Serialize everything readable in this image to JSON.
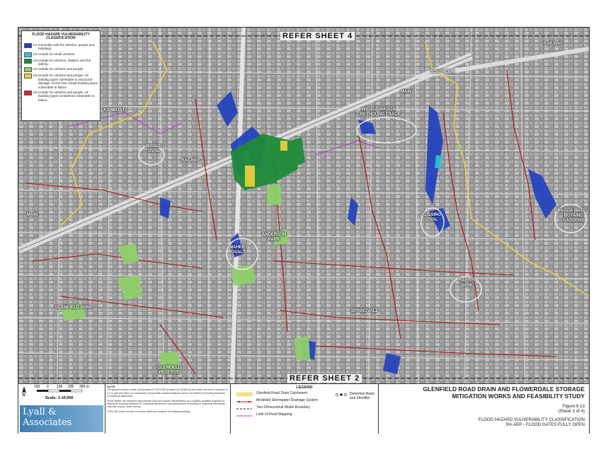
{
  "map": {
    "refer_top": "REFER SHEET 4",
    "refer_bottom": "REFER SHEET 2",
    "labels": {
      "railway_ne": "RAILWAY",
      "southern": "SOUTHERN",
      "main_ne": "MAIN",
      "ashmont": "ASHMONT",
      "wagga_track": "WAGGA WAGGA\nGREYHOUND TRACK",
      "bisson_oval": "BISSON\nOVAL",
      "railway_w": "RAILWAY",
      "main_w": "MAIN",
      "gissing_oval": "GISSING\nOVAL",
      "wagga_gardens": "WAGGA WAGGA\nBOTANIC\nGARDENS",
      "maher_oval": "MAHER\nOVAL",
      "anderson_park": "ANDERSON\nPARK",
      "harris_park": "HARRIS\nPARK",
      "glenfield_park": "GLENFIELD PARK",
      "glenfield_reserve": "GLENFIELD\nRESERVE",
      "springvale": "SPRINGVALE"
    }
  },
  "hazard_legend": {
    "title": "FLOOD HAZARD VULNERABILITY\nCLASSIFICATION",
    "items": [
      {
        "code": "H1",
        "color": "#1f3fbf",
        "text": "Generally safe for vehicles, people and buildings."
      },
      {
        "code": "H2",
        "color": "#27c8d8",
        "text": "Unsafe for small vehicles."
      },
      {
        "code": "H3",
        "color": "#1f8a3a",
        "text": "Unsafe for vehicles, children and the elderly."
      },
      {
        "code": "H4",
        "color": "#8fd06a",
        "text": "Unsafe for vehicles and people."
      },
      {
        "code": "H5",
        "color": "#f0d23a",
        "text": "Unsafe for vehicles and people. All building types vulnerable to structural damage. Some less robust building types vulnerable to failure."
      },
      {
        "code": "H6",
        "color": "#e02020",
        "text": "Unsafe for vehicles and people. All building types considered vulnerable to failure."
      }
    ]
  },
  "scale": {
    "north": "N",
    "ticks": [
      "100",
      "0",
      "100",
      "200",
      "300 m"
    ],
    "label": "Scale: 1:10,000"
  },
  "logo": {
    "line1": "Lyall &",
    "line2": "Associates"
  },
  "notes": {
    "title": "NOTE:",
    "paragraphs": [
      "The ground surface model incorporated in TUFLOW is based on LiDAR survey which has been sampled on a 2 m grid and does not necessarily incorporate localised features which can influence flooding behaviour in individual allotments.",
      "Flood depths are therefore approximate only and require interpretation by a suitably qualified engineer to determine flooding behaviour in individual allotments. Any assessment of flooding in individual allotments may also require a site survey.",
      "TUFLOW model results not shown within the footprint of existing buildings."
    ]
  },
  "legend": {
    "title": "LEGEND",
    "items": [
      {
        "text": "Glenfield Road Drain Catchment"
      },
      {
        "text": "Modelled Stormwater Drainage System"
      },
      {
        "text": "Two-Dimensional Model Boundary"
      },
      {
        "text": "Limit of Flood Mapping"
      }
    ],
    "detention": "Detention Basin and Identifier"
  },
  "title": {
    "line1": "GLENFIELD ROAD DRAIN AND FLOWERDALE STORAGE",
    "line2": "MITIGATION WORKS AND FEASIBILITY STUDY",
    "figure": "Figure 6.13",
    "sheet": "(Sheet 3 of 4)",
    "line3": "FLOOD HAZARD VULNERABILITY CLASSIFICATION",
    "line4": "5% AEP - FLOOD GATES FULLY OPEN"
  }
}
